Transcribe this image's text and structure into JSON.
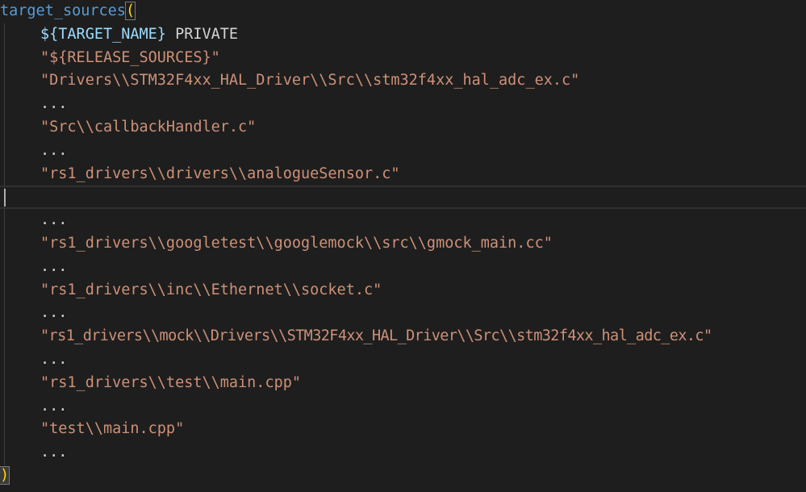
{
  "code": {
    "func_name": "target_sources",
    "open_paren": "(",
    "close_paren": ")",
    "target_var": "${TARGET_NAME}",
    "private_kw": " PRIVATE",
    "lines": [
      "\"${RELEASE_SOURCES}\"",
      "\"Drivers\\\\STM32F4xx_HAL_Driver\\\\Src\\\\stm32f4xx_hal_adc_ex.c\"",
      "...",
      "\"Src\\\\callbackHandler.c\"",
      "...",
      "\"rs1_drivers\\\\drivers\\\\analogueSensor.c\"",
      "",
      "...",
      "\"rs1_drivers\\\\googletest\\\\googlemock\\\\src\\\\gmock_main.cc\"",
      "...",
      "\"rs1_drivers\\\\inc\\\\Ethernet\\\\socket.c\"",
      "...",
      "\"rs1_drivers\\\\mock\\\\Drivers\\\\STM32F4xx_HAL_Driver\\\\Src\\\\stm32f4xx_hal_adc_ex.c\"",
      "...",
      "\"rs1_drivers\\\\test\\\\main.cpp\"",
      "...",
      "\"test\\\\main.cpp\"",
      "..."
    ]
  },
  "colors": {
    "background": "#1e1e1e",
    "function": "#569cd6",
    "variable": "#9cdcfe",
    "string": "#ce9178",
    "bracket": "#ffd700"
  }
}
